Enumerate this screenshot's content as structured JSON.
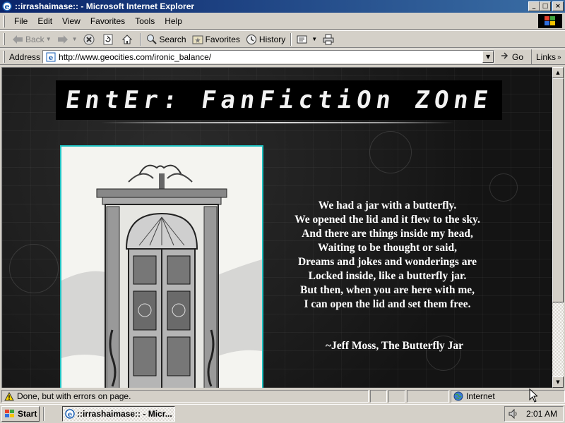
{
  "window": {
    "title": "::irrashaimase:: - Microsoft Internet Explorer",
    "minimize_glyph": "_",
    "maximize_glyph": "□",
    "close_glyph": "×"
  },
  "menubar": {
    "file": "File",
    "edit": "Edit",
    "view": "View",
    "favorites": "Favorites",
    "tools": "Tools",
    "help": "Help"
  },
  "toolbar": {
    "back": "Back",
    "search": "Search",
    "favorites": "Favorites",
    "history": "History"
  },
  "addressbar": {
    "label": "Address",
    "url": "http://www.geocities.com/ironic_balance/",
    "go": "Go",
    "links": "Links"
  },
  "page": {
    "banner": "EntEr: FanFictiOn ZOnE",
    "poem_lines": [
      "We had a jar with a butterfly.",
      "We opened the lid and it flew to the sky.",
      "And there are things inside my head,",
      "Waiting to be thought or said,",
      "Dreams and jokes and wonderings are",
      "Locked inside, like a butterfly jar.",
      "But then, when you are here with me,",
      "I can open the lid and set them free."
    ],
    "attribution": "~Jeff Moss, The Butterfly Jar"
  },
  "statusbar": {
    "message": "Done, but with errors on page.",
    "zone": "Internet"
  },
  "taskbar": {
    "start": "Start",
    "task": "::irrashaimase:: - Micr...",
    "clock": "2:01 AM"
  },
  "colors": {
    "titlebar": "#0a246a",
    "frame_border": "#1fc2c2",
    "page_background": "#1a1a1a",
    "poem_text": "#ffffff"
  },
  "icons": {
    "app": "ie-logo-icon",
    "back": "back-arrow-icon",
    "forward": "forward-arrow-icon",
    "stop": "stop-icon",
    "refresh": "refresh-icon",
    "home": "home-icon",
    "search": "search-icon",
    "favorites": "favorites-icon",
    "history": "history-icon",
    "mail": "mail-icon",
    "print": "print-icon",
    "warning": "warning-icon",
    "zone": "globe-icon",
    "volume": "speaker-icon"
  }
}
